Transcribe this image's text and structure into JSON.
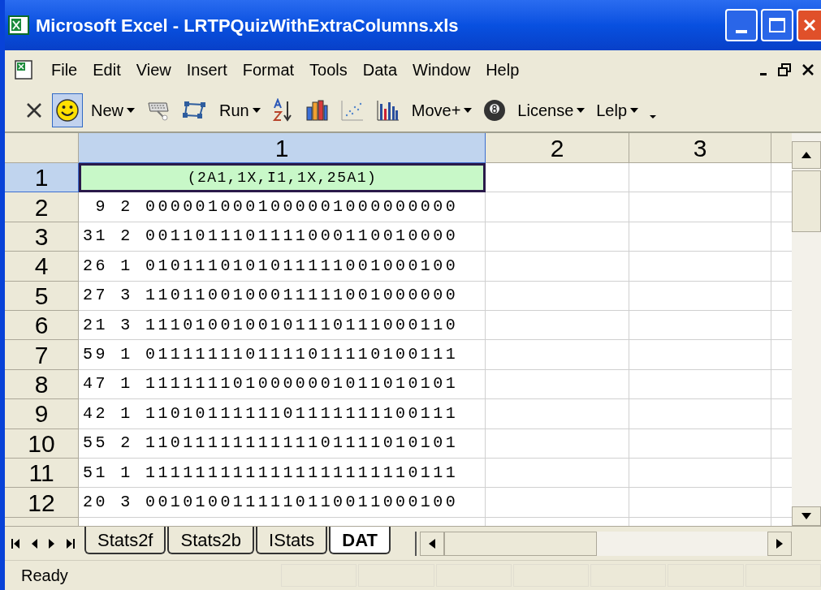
{
  "window": {
    "title": "Microsoft Excel - LRTPQuizWithExtraColumns.xls"
  },
  "menu": [
    {
      "label": "File"
    },
    {
      "label": "Edit"
    },
    {
      "label": "View"
    },
    {
      "label": "Insert"
    },
    {
      "label": "Format"
    },
    {
      "label": "Tools"
    },
    {
      "label": "Data"
    },
    {
      "label": "Window"
    },
    {
      "label": "Help"
    }
  ],
  "toolbar": [
    {
      "kind": "close",
      "pressed": false
    },
    {
      "kind": "smiley",
      "pressed": true
    },
    {
      "kind": "dropdown",
      "label": "New",
      "pressed": false
    },
    {
      "kind": "keyboard",
      "pressed": false
    },
    {
      "kind": "shape",
      "pressed": false
    },
    {
      "kind": "dropdown",
      "label": "Run",
      "pressed": false
    },
    {
      "kind": "sort",
      "pressed": false
    },
    {
      "kind": "bars",
      "pressed": false
    },
    {
      "kind": "scatter",
      "pressed": false
    },
    {
      "kind": "columns",
      "pressed": false
    },
    {
      "kind": "dropdown",
      "label": "Move+",
      "pressed": false
    },
    {
      "kind": "ball",
      "pressed": false
    },
    {
      "kind": "dropdown",
      "label": "License",
      "pressed": false
    },
    {
      "kind": "dropdown",
      "label": "Lelp",
      "pressed": false
    },
    {
      "kind": "more",
      "pressed": false
    }
  ],
  "grid": {
    "columns": [
      {
        "label": "1",
        "selected": true
      },
      {
        "label": "2",
        "selected": false
      },
      {
        "label": "3",
        "selected": false
      }
    ],
    "rows": [
      {
        "header": "1",
        "selected": true,
        "value": "(2A1,1X,I1,1X,25A1)"
      },
      {
        "header": "2",
        "selected": false,
        "value": " 9 2 0000010001000001000000000"
      },
      {
        "header": "3",
        "selected": false,
        "value": "31 2 0011011101111000110010000"
      },
      {
        "header": "4",
        "selected": false,
        "value": "26 1 0101110101011111001000100"
      },
      {
        "header": "5",
        "selected": false,
        "value": "27 3 1101100100011111001000000"
      },
      {
        "header": "6",
        "selected": false,
        "value": "21 3 1110100100101110111000110"
      },
      {
        "header": "7",
        "selected": false,
        "value": "59 1 0111111101111011110100111"
      },
      {
        "header": "8",
        "selected": false,
        "value": "47 1 1111111010000001011010101"
      },
      {
        "header": "9",
        "selected": false,
        "value": "42 1 1101011111101111111100111"
      },
      {
        "header": "10",
        "selected": false,
        "value": "55 2 1101111111111101111010101"
      },
      {
        "header": "11",
        "selected": false,
        "value": "51 1 1111111111111111111110111"
      },
      {
        "header": "12",
        "selected": false,
        "value": "20 3 0010100111110110011000100"
      }
    ]
  },
  "sheet_tabs": [
    {
      "label": "Stats2f",
      "selected": false
    },
    {
      "label": "Stats2b",
      "selected": false
    },
    {
      "label": "IStats",
      "selected": false
    },
    {
      "label": "DAT",
      "selected": true
    }
  ],
  "status_bar": {
    "text": "Ready"
  }
}
